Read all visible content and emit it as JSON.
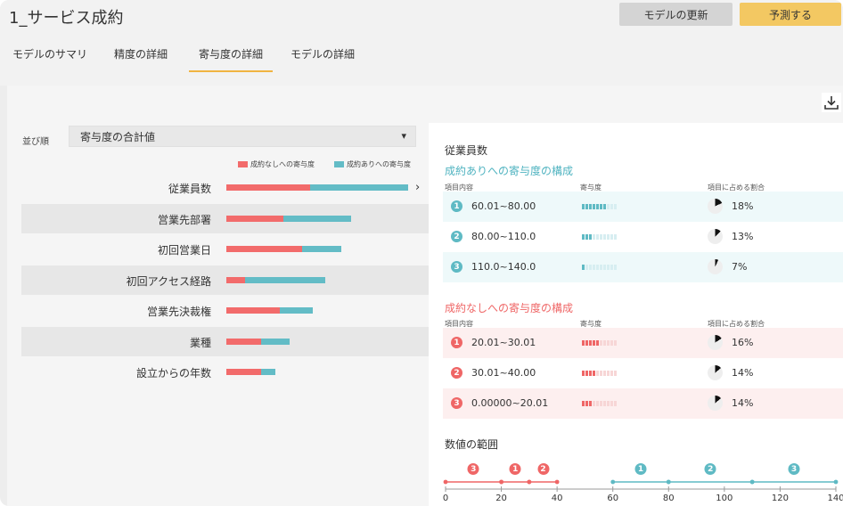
{
  "header": {
    "title": "1_サービス成約",
    "update_button": "モデルの更新",
    "predict_button": "予測する"
  },
  "tabs": [
    {
      "label": "モデルのサマリ",
      "active": false
    },
    {
      "label": "精度の詳細",
      "active": false
    },
    {
      "label": "寄与度の詳細",
      "active": true
    },
    {
      "label": "モデルの詳細",
      "active": false
    }
  ],
  "toolbar": {
    "download_icon": "download-icon"
  },
  "sort": {
    "label": "並び順",
    "selected": "寄与度の合計値"
  },
  "legend": {
    "negative": "成約なしへの寄与度",
    "positive": "成約ありへの寄与度"
  },
  "colors": {
    "negative": "#f26b6b",
    "positive": "#63bcc6",
    "accent": "#f3c862"
  },
  "features": [
    {
      "label": "従業員数",
      "negative": 0.41,
      "positive": 0.48
    },
    {
      "label": "営業先部署",
      "negative": 0.28,
      "positive": 0.33
    },
    {
      "label": "初回営業日",
      "negative": 0.37,
      "positive": 0.19
    },
    {
      "label": "初回アクセス経路",
      "negative": 0.09,
      "positive": 0.39
    },
    {
      "label": "営業先決裁権",
      "negative": 0.26,
      "positive": 0.16
    },
    {
      "label": "業種",
      "negative": 0.17,
      "positive": 0.14
    },
    {
      "label": "設立からの年数",
      "negative": 0.17,
      "positive": 0.07
    }
  ],
  "detail": {
    "title": "従業員数",
    "positive_section": {
      "title": "成約ありへの寄与度の構成",
      "col_item": "項目内容",
      "col_contrib": "寄与度",
      "col_share": "項目に占める割合",
      "items": [
        {
          "rank": "1",
          "range": "60.01~80.00",
          "level": 7,
          "share": 18,
          "share_label": "18%"
        },
        {
          "rank": "2",
          "range": "80.00~110.0",
          "level": 3,
          "share": 13,
          "share_label": "13%"
        },
        {
          "rank": "3",
          "range": "110.0~140.0",
          "level": 1,
          "share": 7,
          "share_label": "7%"
        }
      ]
    },
    "negative_section": {
      "title": "成約なしへの寄与度の構成",
      "col_item": "項目内容",
      "col_contrib": "寄与度",
      "col_share": "項目に占める割合",
      "items": [
        {
          "rank": "1",
          "range": "20.01~30.01",
          "level": 5,
          "share": 16,
          "share_label": "16%"
        },
        {
          "rank": "2",
          "range": "30.01~40.00",
          "level": 4,
          "share": 14,
          "share_label": "14%"
        },
        {
          "rank": "3",
          "range": "0.00000~20.01",
          "level": 3,
          "share": 14,
          "share_label": "14%"
        }
      ]
    },
    "range_chart": {
      "title": "数値の範囲",
      "ticks": [
        "0",
        "20",
        "40",
        "60",
        "80",
        "100",
        "120",
        "140"
      ],
      "negative": [
        {
          "rank": "3",
          "from": 0,
          "to": 20.01
        },
        {
          "rank": "1",
          "from": 20.01,
          "to": 30.01
        },
        {
          "rank": "2",
          "from": 30.01,
          "to": 40
        }
      ],
      "positive": [
        {
          "rank": "1",
          "from": 60.01,
          "to": 80
        },
        {
          "rank": "2",
          "from": 80,
          "to": 110
        },
        {
          "rank": "3",
          "from": 110,
          "to": 140
        }
      ]
    }
  }
}
